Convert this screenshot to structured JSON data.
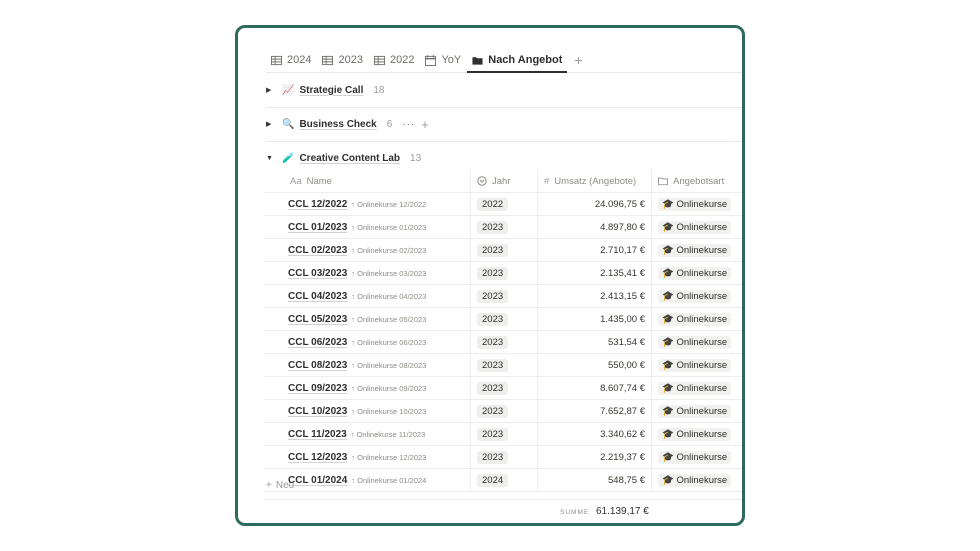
{
  "tabs": [
    {
      "label": "2024",
      "icon": "table-icon"
    },
    {
      "label": "2023",
      "icon": "table-icon"
    },
    {
      "label": "2022",
      "icon": "table-icon"
    },
    {
      "label": "YoY",
      "icon": "calendar-icon"
    },
    {
      "label": "Nach Angebot",
      "icon": "folder-icon",
      "active": true
    }
  ],
  "groups": [
    {
      "emoji": "📈",
      "name": "Strategie Call",
      "count": "18",
      "expanded": false
    },
    {
      "emoji": "🔍",
      "name": "Business Check",
      "count": "6",
      "expanded": false
    },
    {
      "emoji": "🧪",
      "name": "Creative Content Lab",
      "count": "13",
      "expanded": true
    }
  ],
  "columns": {
    "name": "Name",
    "name_prefix": "Aa",
    "year": "Jahr",
    "revenue": "Umsatz (Angebote)",
    "revenue_prefix": "#",
    "type": "Angebotsart"
  },
  "rows": [
    {
      "name": "CCL 12/2022",
      "rel": "Onlinekurse 12/2022",
      "year": "2022",
      "revenue": "24.096,75 €",
      "type": "Onlinekurse"
    },
    {
      "name": "CCL 01/2023",
      "rel": "Onlinekurse 01/2023",
      "year": "2023",
      "revenue": "4.897,80 €",
      "type": "Onlinekurse"
    },
    {
      "name": "CCL 02/2023",
      "rel": "Onlinekurse 02/2023",
      "year": "2023",
      "revenue": "2.710,17 €",
      "type": "Onlinekurse"
    },
    {
      "name": "CCL 03/2023",
      "rel": "Onlinekurse 03/2023",
      "year": "2023",
      "revenue": "2.135,41 €",
      "type": "Onlinekurse"
    },
    {
      "name": "CCL 04/2023",
      "rel": "Onlinekurse 04/2023",
      "year": "2023",
      "revenue": "2.413,15 €",
      "type": "Onlinekurse"
    },
    {
      "name": "CCL 05/2023",
      "rel": "Onlinekurse 05/2023",
      "year": "2023",
      "revenue": "1.435,00 €",
      "type": "Onlinekurse"
    },
    {
      "name": "CCL 06/2023",
      "rel": "Onlinekurse 06/2023",
      "year": "2023",
      "revenue": "531,54 €",
      "type": "Onlinekurse"
    },
    {
      "name": "CCL 08/2023",
      "rel": "Onlinekurse 08/2023",
      "year": "2023",
      "revenue": "550,00 €",
      "type": "Onlinekurse"
    },
    {
      "name": "CCL 09/2023",
      "rel": "Onlinekurse 09/2023",
      "year": "2023",
      "revenue": "8.607,74 €",
      "type": "Onlinekurse"
    },
    {
      "name": "CCL 10/2023",
      "rel": "Onlinekurse 10/2023",
      "year": "2023",
      "revenue": "7.652,87 €",
      "type": "Onlinekurse"
    },
    {
      "name": "CCL 11/2023",
      "rel": "Onlinekurse 11/2023",
      "year": "2023",
      "revenue": "3.340,62 €",
      "type": "Onlinekurse"
    },
    {
      "name": "CCL 12/2023",
      "rel": "Onlinekurse 12/2023",
      "year": "2023",
      "revenue": "2.219,37 €",
      "type": "Onlinekurse"
    },
    {
      "name": "CCL 01/2024",
      "rel": "Onlinekurse 01/2024",
      "year": "2024",
      "revenue": "548,75 €",
      "type": "Onlinekurse"
    }
  ],
  "type_emoji": "🎓",
  "new_label": "Neu",
  "sum_label": "SUMME",
  "sum_value": "61.139,17 €",
  "colors": {
    "frame": "#2e6b5c"
  }
}
